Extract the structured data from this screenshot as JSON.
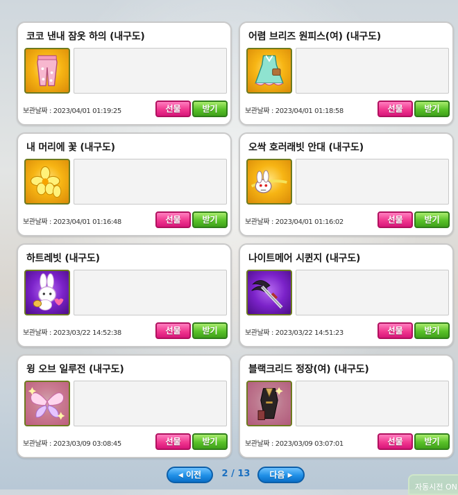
{
  "items": [
    {
      "title": "코코 낸내 잠옷 하의 (내구도)",
      "date_label": "보관날짜 :",
      "date": "2023/04/01 01:19:25",
      "icon": "pink-pajama-pants-icon",
      "bg": "gold"
    },
    {
      "title": "어렴 브리즈 원피스(여) (내구도)",
      "date_label": "보관날짜 :",
      "date": "2023/04/01 01:18:58",
      "icon": "mint-dress-icon",
      "bg": "gold"
    },
    {
      "title": "내 머리에 꽃 (내구도)",
      "date_label": "보관날짜 :",
      "date": "2023/04/01 01:16:48",
      "icon": "yellow-flower-icon",
      "bg": "gold"
    },
    {
      "title": "오싹 호러래빗 안대 (내구도)",
      "date_label": "보관날짜 :",
      "date": "2023/04/01 01:16:02",
      "icon": "horror-rabbit-eyepatch-icon",
      "bg": "gold"
    },
    {
      "title": "하트레빗 (내구도)",
      "date_label": "보관날짜 :",
      "date": "2023/03/22 14:52:38",
      "icon": "heart-rabbit-icon",
      "bg": "purple"
    },
    {
      "title": "나이트메어 시퀸지 (내구도)",
      "date_label": "보관날짜 :",
      "date": "2023/03/22 14:51:23",
      "icon": "nightmare-weapon-icon",
      "bg": "purple"
    },
    {
      "title": "윙 오브 일루전 (내구도)",
      "date_label": "보관날짜 :",
      "date": "2023/03/09 03:08:45",
      "icon": "butterfly-wings-icon",
      "bg": "rose"
    },
    {
      "title": "블랙크리드 정장(여) (내구도)",
      "date_label": "보관날짜 :",
      "date": "2023/03/09 03:07:01",
      "icon": "black-suit-icon",
      "bg": "rose"
    }
  ],
  "buttons": {
    "gift": "선물",
    "receive": "받기"
  },
  "pagination": {
    "prev": "이전",
    "next": "다음",
    "current": 2,
    "total": 13,
    "display": "2 / 13"
  },
  "auto_badge": "자동시전 ON",
  "colors": {
    "gift": "#f0388f",
    "receive": "#58c128",
    "pager": "#1f8fe6"
  }
}
